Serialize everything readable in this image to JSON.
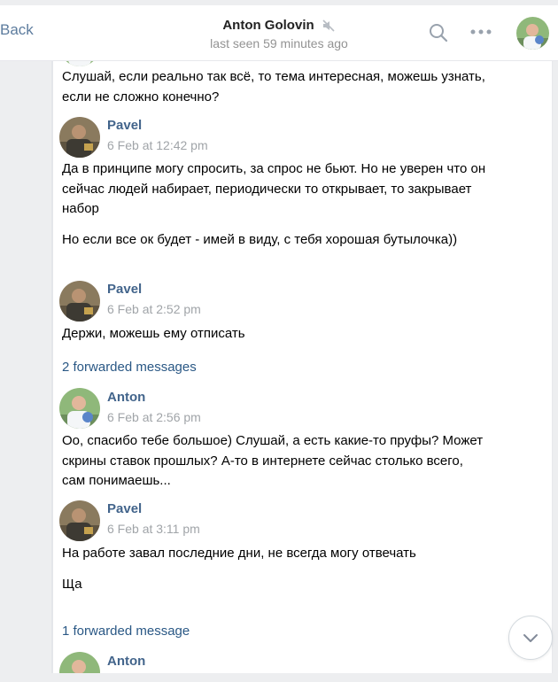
{
  "header": {
    "back_label": "Back",
    "title": "Anton Golovin",
    "status": "last seen 59 minutes ago",
    "icons": [
      "mute-icon",
      "search-icon",
      "more-icon",
      "avatar"
    ]
  },
  "messages": [
    {
      "kind": "text",
      "text": "Слушай, если реально так всё, то тема интересная, можешь узнать, если не сложно конечно?"
    },
    {
      "kind": "group",
      "author": "Pavel",
      "time": "6 Feb at 12:42 pm",
      "texts": [
        "Да в принципе могу спросить, за спрос не бьют. Но не уверен что он сейчас людей набирает, периодически то открывает, то закрывает набор",
        "Но если все ок будет - имей в виду, с тебя хорошая бутылочка))"
      ]
    },
    {
      "kind": "group",
      "author": "Pavel",
      "time": "6 Feb at 2:52 pm",
      "texts": [
        "Держи, можешь ему отписать"
      ],
      "forwarded": "2 forwarded messages"
    },
    {
      "kind": "group",
      "author": "Anton",
      "time": "6 Feb at 2:56 pm",
      "texts": [
        "Оо, спасибо тебе большое) Слушай, а есть какие-то пруфы? Может скрины ставок прошлых? А-то в интернете сейчас столько всего, сам понимаешь..."
      ]
    },
    {
      "kind": "group",
      "author": "Pavel",
      "time": "6 Feb at 3:11 pm",
      "texts": [
        "На работе завал последние дни, не всегда могу отвечать",
        "Ща"
      ],
      "forwarded": "1 forwarded message"
    },
    {
      "kind": "group",
      "author": "Anton"
    }
  ],
  "colors": {
    "link": "#2a5885",
    "author": "#42648b",
    "time": "#a0a4a8",
    "background": "#edeef0",
    "panel": "#ffffff"
  }
}
